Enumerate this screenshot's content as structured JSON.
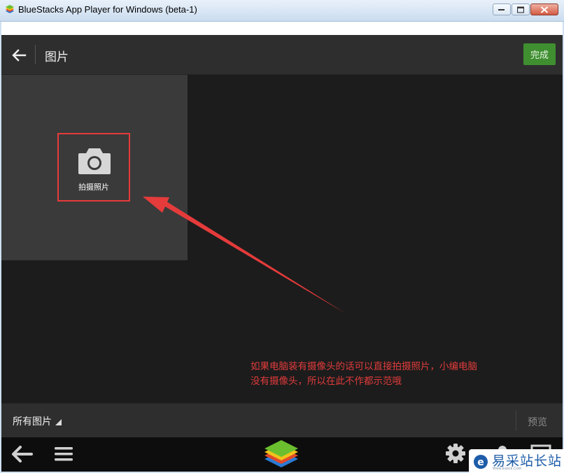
{
  "window": {
    "title": "BlueStacks App Player for Windows (beta-1)"
  },
  "header": {
    "title": "图片",
    "done_label": "完成"
  },
  "camera_tile": {
    "label": "拍摄照片"
  },
  "annotation": {
    "line1": "如果电脑装有摄像头的话可以直接拍摄照片，小编电脑",
    "line2": "没有摄像头，所以在此不作都示范哦"
  },
  "bottom_bar": {
    "album_label": "所有图片",
    "preview_label": "预览"
  },
  "watermark": {
    "text": "易采站长站",
    "sub": "Www.Easck.Com"
  },
  "colors": {
    "done_button": "#3f8f31",
    "highlight_box": "#e53b3b",
    "annotation_text": "#e03b3b"
  }
}
